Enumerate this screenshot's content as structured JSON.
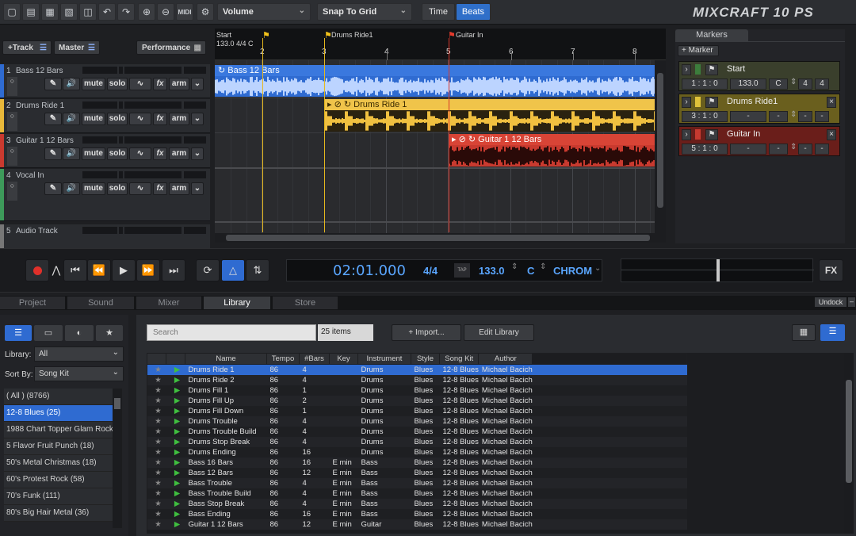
{
  "toolbar": {
    "volume": "Volume",
    "snap": "Snap To Grid",
    "time_label": "Time",
    "beats_label": "Beats",
    "logo": "MIXCRAFT 10 PS",
    "midi": "MIDI"
  },
  "track_panel": {
    "add_track": "+Track",
    "master": "Master",
    "performance": "Performance"
  },
  "tracks": [
    {
      "num": "1",
      "name": "Bass 12 Bars",
      "color": "#2f6bd1"
    },
    {
      "num": "2",
      "name": "Drums Ride 1",
      "color": "#e8b83a"
    },
    {
      "num": "3",
      "name": "Guitar 1 12 Bars",
      "color": "#c93a2f"
    },
    {
      "num": "4",
      "name": "Vocal In",
      "color": "#3d9a5a"
    },
    {
      "num": "5",
      "name": "Audio Track",
      "color": "#777777"
    }
  ],
  "track_buttons": {
    "mute": "mute",
    "solo": "solo",
    "fx": "fx",
    "arm": "arm"
  },
  "ruler": {
    "start": "Start",
    "tempo_sig": "133.0 4/4 C",
    "marker2": "Drums Ride1",
    "marker3": "Guitar In",
    "bars": [
      "2",
      "3",
      "4",
      "5",
      "6",
      "7",
      "8"
    ]
  },
  "clips": {
    "bass": "Bass 12 Bars",
    "drums": "Drums Ride 1",
    "guitar": "Guitar 1 12 Bars"
  },
  "markers_panel": {
    "title": "Markers",
    "add": "+ Marker",
    "items": [
      {
        "name": "Start",
        "pos": "1 : 1 : 0",
        "tempo": "133.0",
        "key": "C",
        "sig_a": "4",
        "sig_b": "4",
        "color": "#3c7d3c"
      },
      {
        "name": "Drums Ride1",
        "pos": "3 : 1 : 0",
        "tempo": "-",
        "key": "-",
        "sig_a": "-",
        "sig_b": "-",
        "color": "#e0c23a"
      },
      {
        "name": "Guitar In",
        "pos": "5 : 1 : 0",
        "tempo": "-",
        "key": "-",
        "sig_a": "-",
        "sig_b": "-",
        "color": "#c63a30"
      }
    ]
  },
  "transport": {
    "time": "02:01.000",
    "sig": "4/4",
    "tap": "TAP",
    "tempo": "133.0",
    "key": "C",
    "mode": "CHROM",
    "fx": "FX"
  },
  "tabs": {
    "project": "Project",
    "sound": "Sound",
    "mixer": "Mixer",
    "library": "Library",
    "store": "Store",
    "undock": "Undock"
  },
  "library": {
    "library_label": "Library:",
    "library_value": "All",
    "sort_label": "Sort By:",
    "sort_value": "Song Kit",
    "search_placeholder": "Search",
    "count": "25 items",
    "import": "+ Import...",
    "edit": "Edit Library",
    "categories": [
      "( All ) (8766)",
      "12-8 Blues (25)",
      "1988 Chart Topper Glam Rock (",
      "5 Flavor Fruit Punch (18)",
      "50's Metal Christmas (18)",
      "60's Protest Rock (58)",
      "70's Funk (111)",
      "80's Big Hair Metal (36)"
    ],
    "columns": [
      "Name",
      "Tempo",
      "#Bars",
      "Key",
      "Instrument",
      "Style",
      "Song Kit",
      "Author"
    ],
    "rows": [
      [
        "Drums Ride 1",
        "86",
        "4",
        "",
        "Drums",
        "Blues",
        "12-8 Blues",
        "Michael Bacich"
      ],
      [
        "Drums Ride 2",
        "86",
        "4",
        "",
        "Drums",
        "Blues",
        "12-8 Blues",
        "Michael Bacich"
      ],
      [
        "Drums Fill 1",
        "86",
        "1",
        "",
        "Drums",
        "Blues",
        "12-8 Blues",
        "Michael Bacich"
      ],
      [
        "Drums Fill Up",
        "86",
        "2",
        "",
        "Drums",
        "Blues",
        "12-8 Blues",
        "Michael Bacich"
      ],
      [
        "Drums Fill Down",
        "86",
        "1",
        "",
        "Drums",
        "Blues",
        "12-8 Blues",
        "Michael Bacich"
      ],
      [
        "Drums Trouble",
        "86",
        "4",
        "",
        "Drums",
        "Blues",
        "12-8 Blues",
        "Michael Bacich"
      ],
      [
        "Drums Trouble Build",
        "86",
        "4",
        "",
        "Drums",
        "Blues",
        "12-8 Blues",
        "Michael Bacich"
      ],
      [
        "Drums Stop Break",
        "86",
        "4",
        "",
        "Drums",
        "Blues",
        "12-8 Blues",
        "Michael Bacich"
      ],
      [
        "Drums Ending",
        "86",
        "16",
        "",
        "Drums",
        "Blues",
        "12-8 Blues",
        "Michael Bacich"
      ],
      [
        "Bass 16 Bars",
        "86",
        "16",
        "E min",
        "Bass",
        "Blues",
        "12-8 Blues",
        "Michael Bacich"
      ],
      [
        "Bass 12 Bars",
        "86",
        "12",
        "E min",
        "Bass",
        "Blues",
        "12-8 Blues",
        "Michael Bacich"
      ],
      [
        "Bass Trouble",
        "86",
        "4",
        "E min",
        "Bass",
        "Blues",
        "12-8 Blues",
        "Michael Bacich"
      ],
      [
        "Bass Trouble Build",
        "86",
        "4",
        "E min",
        "Bass",
        "Blues",
        "12-8 Blues",
        "Michael Bacich"
      ],
      [
        "Bass Stop Break",
        "86",
        "4",
        "E min",
        "Bass",
        "Blues",
        "12-8 Blues",
        "Michael Bacich"
      ],
      [
        "Bass Ending",
        "86",
        "16",
        "E min",
        "Bass",
        "Blues",
        "12-8 Blues",
        "Michael Bacich"
      ],
      [
        "Guitar 1 12 Bars",
        "86",
        "12",
        "E min",
        "Guitar",
        "Blues",
        "12-8 Blues",
        "Michael Bacich"
      ]
    ]
  }
}
